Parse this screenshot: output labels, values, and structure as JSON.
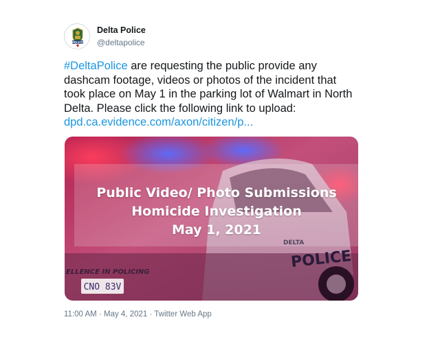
{
  "account": {
    "display_name": "Delta Police",
    "handle": "@deltapolice"
  },
  "tweet": {
    "hashtag": "#DeltaPolice",
    "text": " are requesting the public provide any dashcam footage, videos or photos of the incident that took place on May 1 in the parking lot of Walmart in North Delta. Please click the following link to upload: ",
    "link": "dpd.ca.evidence.com/axon/citizen/p..."
  },
  "media": {
    "line1": "Public Video/ Photo Submissions",
    "line2": "Homicide Investigation",
    "line3": "May 1, 2021",
    "car_door_text": "POLICE",
    "car_brand_text": "DELTA",
    "bumper_text": "ELLENCE IN POLICING",
    "plate_text": "CNO 83V"
  },
  "meta": {
    "time": "11:00 AM",
    "date": "May 4, 2021",
    "source": "Twitter Web App",
    "separator": " · "
  },
  "colors": {
    "link": "#1b95e0",
    "secondary_text": "#657786",
    "photo_tint": "#c2577f"
  },
  "icons": {
    "avatar": "delta-police-badge-icon"
  }
}
